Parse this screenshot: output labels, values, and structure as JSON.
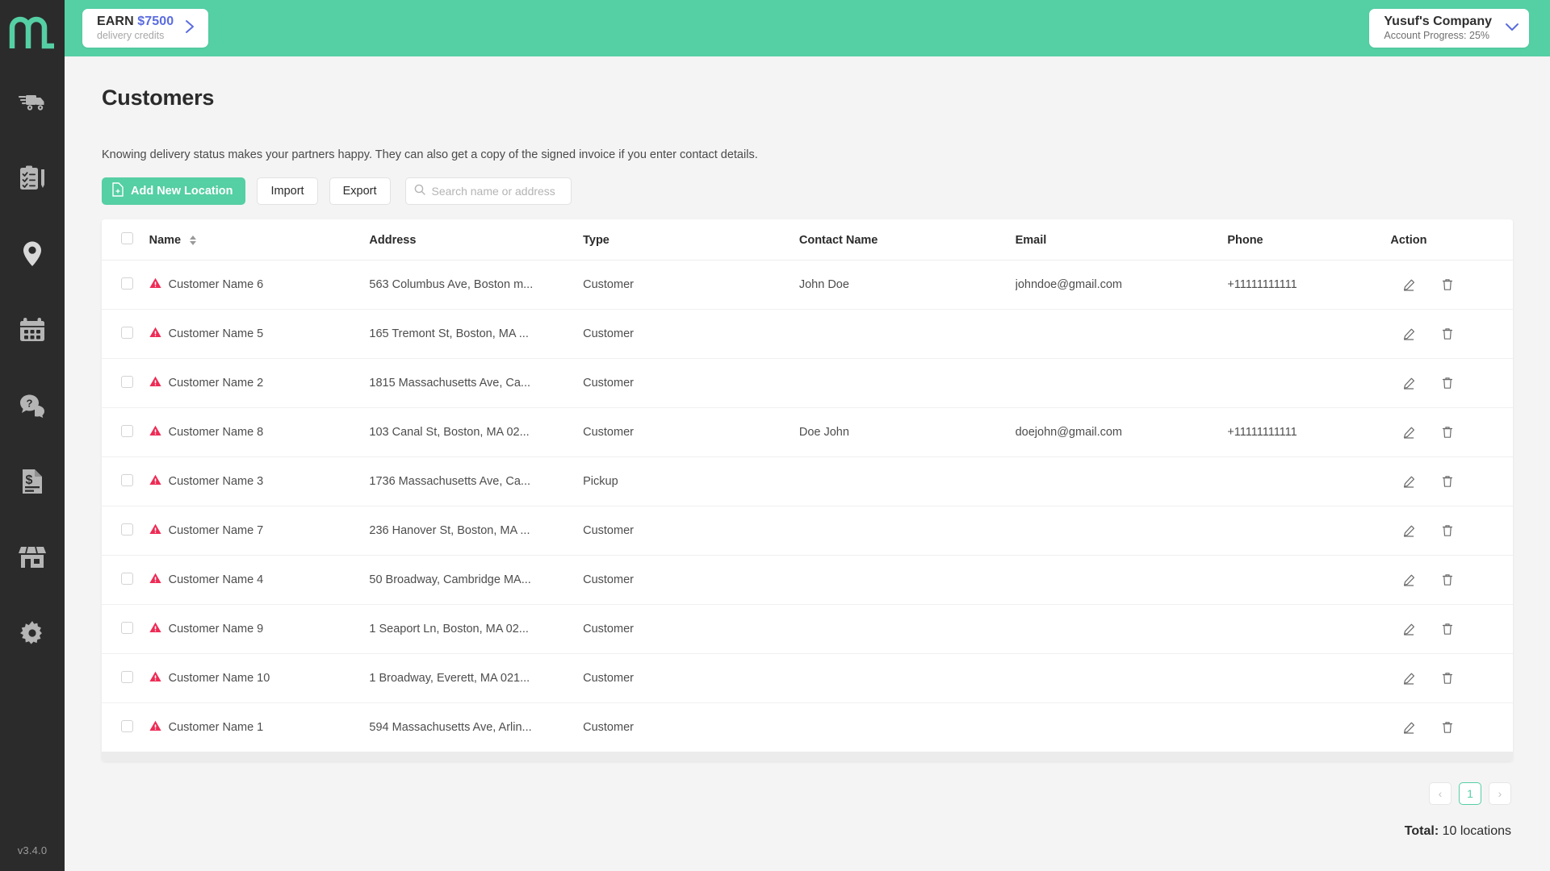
{
  "brand": {
    "logo_text": "m",
    "accent": "#55cfa4",
    "sidebar_bg": "#2b2b2b",
    "warning_color": "#ee2b55",
    "link_color": "#5a6ce0"
  },
  "sidebar": {
    "version": "v3.4.0",
    "items": [
      {
        "name": "deliveries",
        "icon": "truck-icon"
      },
      {
        "name": "tasks",
        "icon": "clipboard-pencil-icon"
      },
      {
        "name": "locations",
        "icon": "map-pin-icon"
      },
      {
        "name": "schedule",
        "icon": "calendar-icon"
      },
      {
        "name": "support",
        "icon": "question-chat-icon"
      },
      {
        "name": "invoices",
        "icon": "invoice-dollar-icon"
      },
      {
        "name": "store",
        "icon": "storefront-icon"
      },
      {
        "name": "settings",
        "icon": "gear-icon"
      }
    ]
  },
  "topbar": {
    "earn": {
      "prefix": "EARN",
      "amount": "$7500",
      "subtitle": "delivery credits"
    },
    "account": {
      "company": "Yusuf's Company",
      "progress": "Account Progress: 25%"
    }
  },
  "page": {
    "title": "Customers",
    "subtitle": "Knowing delivery status makes your partners happy. They can also get a copy of the signed invoice if you enter contact details."
  },
  "toolbar": {
    "add_label": "Add New Location",
    "import_label": "Import",
    "export_label": "Export",
    "search_placeholder": "Search name or address",
    "search_value": ""
  },
  "table": {
    "columns": [
      "Name",
      "Address",
      "Type",
      "Contact Name",
      "Email",
      "Phone",
      "Action"
    ],
    "rows": [
      {
        "name": "Customer Name 6",
        "address": "563 Columbus Ave, Boston m...",
        "type": "Customer",
        "contact": "John Doe",
        "email": "johndoe@gmail.com",
        "phone": "+11111111111"
      },
      {
        "name": "Customer Name 5",
        "address": "165 Tremont St, Boston, MA ...",
        "type": "Customer",
        "contact": "",
        "email": "",
        "phone": ""
      },
      {
        "name": "Customer Name 2",
        "address": "1815 Massachusetts Ave, Ca...",
        "type": "Customer",
        "contact": "",
        "email": "",
        "phone": ""
      },
      {
        "name": "Customer Name 8",
        "address": "103 Canal St, Boston, MA 02...",
        "type": "Customer",
        "contact": "Doe John",
        "email": "doejohn@gmail.com",
        "phone": "+11111111111"
      },
      {
        "name": "Customer Name 3",
        "address": "1736 Massachusetts Ave, Ca...",
        "type": "Pickup",
        "contact": "",
        "email": "",
        "phone": ""
      },
      {
        "name": "Customer Name 7",
        "address": "236 Hanover St, Boston, MA ...",
        "type": "Customer",
        "contact": "",
        "email": "",
        "phone": ""
      },
      {
        "name": "Customer Name 4",
        "address": "50 Broadway, Cambridge MA...",
        "type": "Customer",
        "contact": "",
        "email": "",
        "phone": ""
      },
      {
        "name": "Customer Name 9",
        "address": "1 Seaport Ln, Boston, MA 02...",
        "type": "Customer",
        "contact": "",
        "email": "",
        "phone": ""
      },
      {
        "name": "Customer Name 10",
        "address": "1 Broadway, Everett, MA 021...",
        "type": "Customer",
        "contact": "",
        "email": "",
        "phone": ""
      },
      {
        "name": "Customer Name 1",
        "address": "594 Massachusetts Ave, Arlin...",
        "type": "Customer",
        "contact": "",
        "email": "",
        "phone": ""
      }
    ]
  },
  "pagination": {
    "prev": "‹",
    "next": "›",
    "pages": [
      "1"
    ],
    "current": "1"
  },
  "footer": {
    "total_label": "Total:",
    "total_value": "10 locations"
  }
}
